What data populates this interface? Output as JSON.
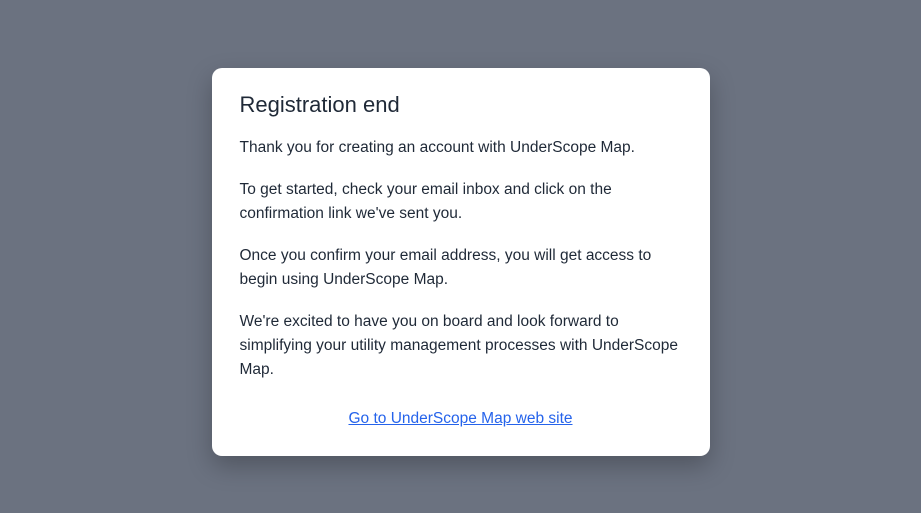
{
  "dialog": {
    "title": "Registration end",
    "paragraphs": [
      "Thank you for creating an account with UnderScope Map.",
      "To get started, check your email inbox and click on the confirmation link we've sent you.",
      "Once you confirm your email address, you will get access to begin using UnderScope Map.",
      "We're excited to have you on board and look forward to simplifying your utility management processes with UnderScope Map."
    ],
    "link_label": "Go to UnderScope Map web site"
  }
}
